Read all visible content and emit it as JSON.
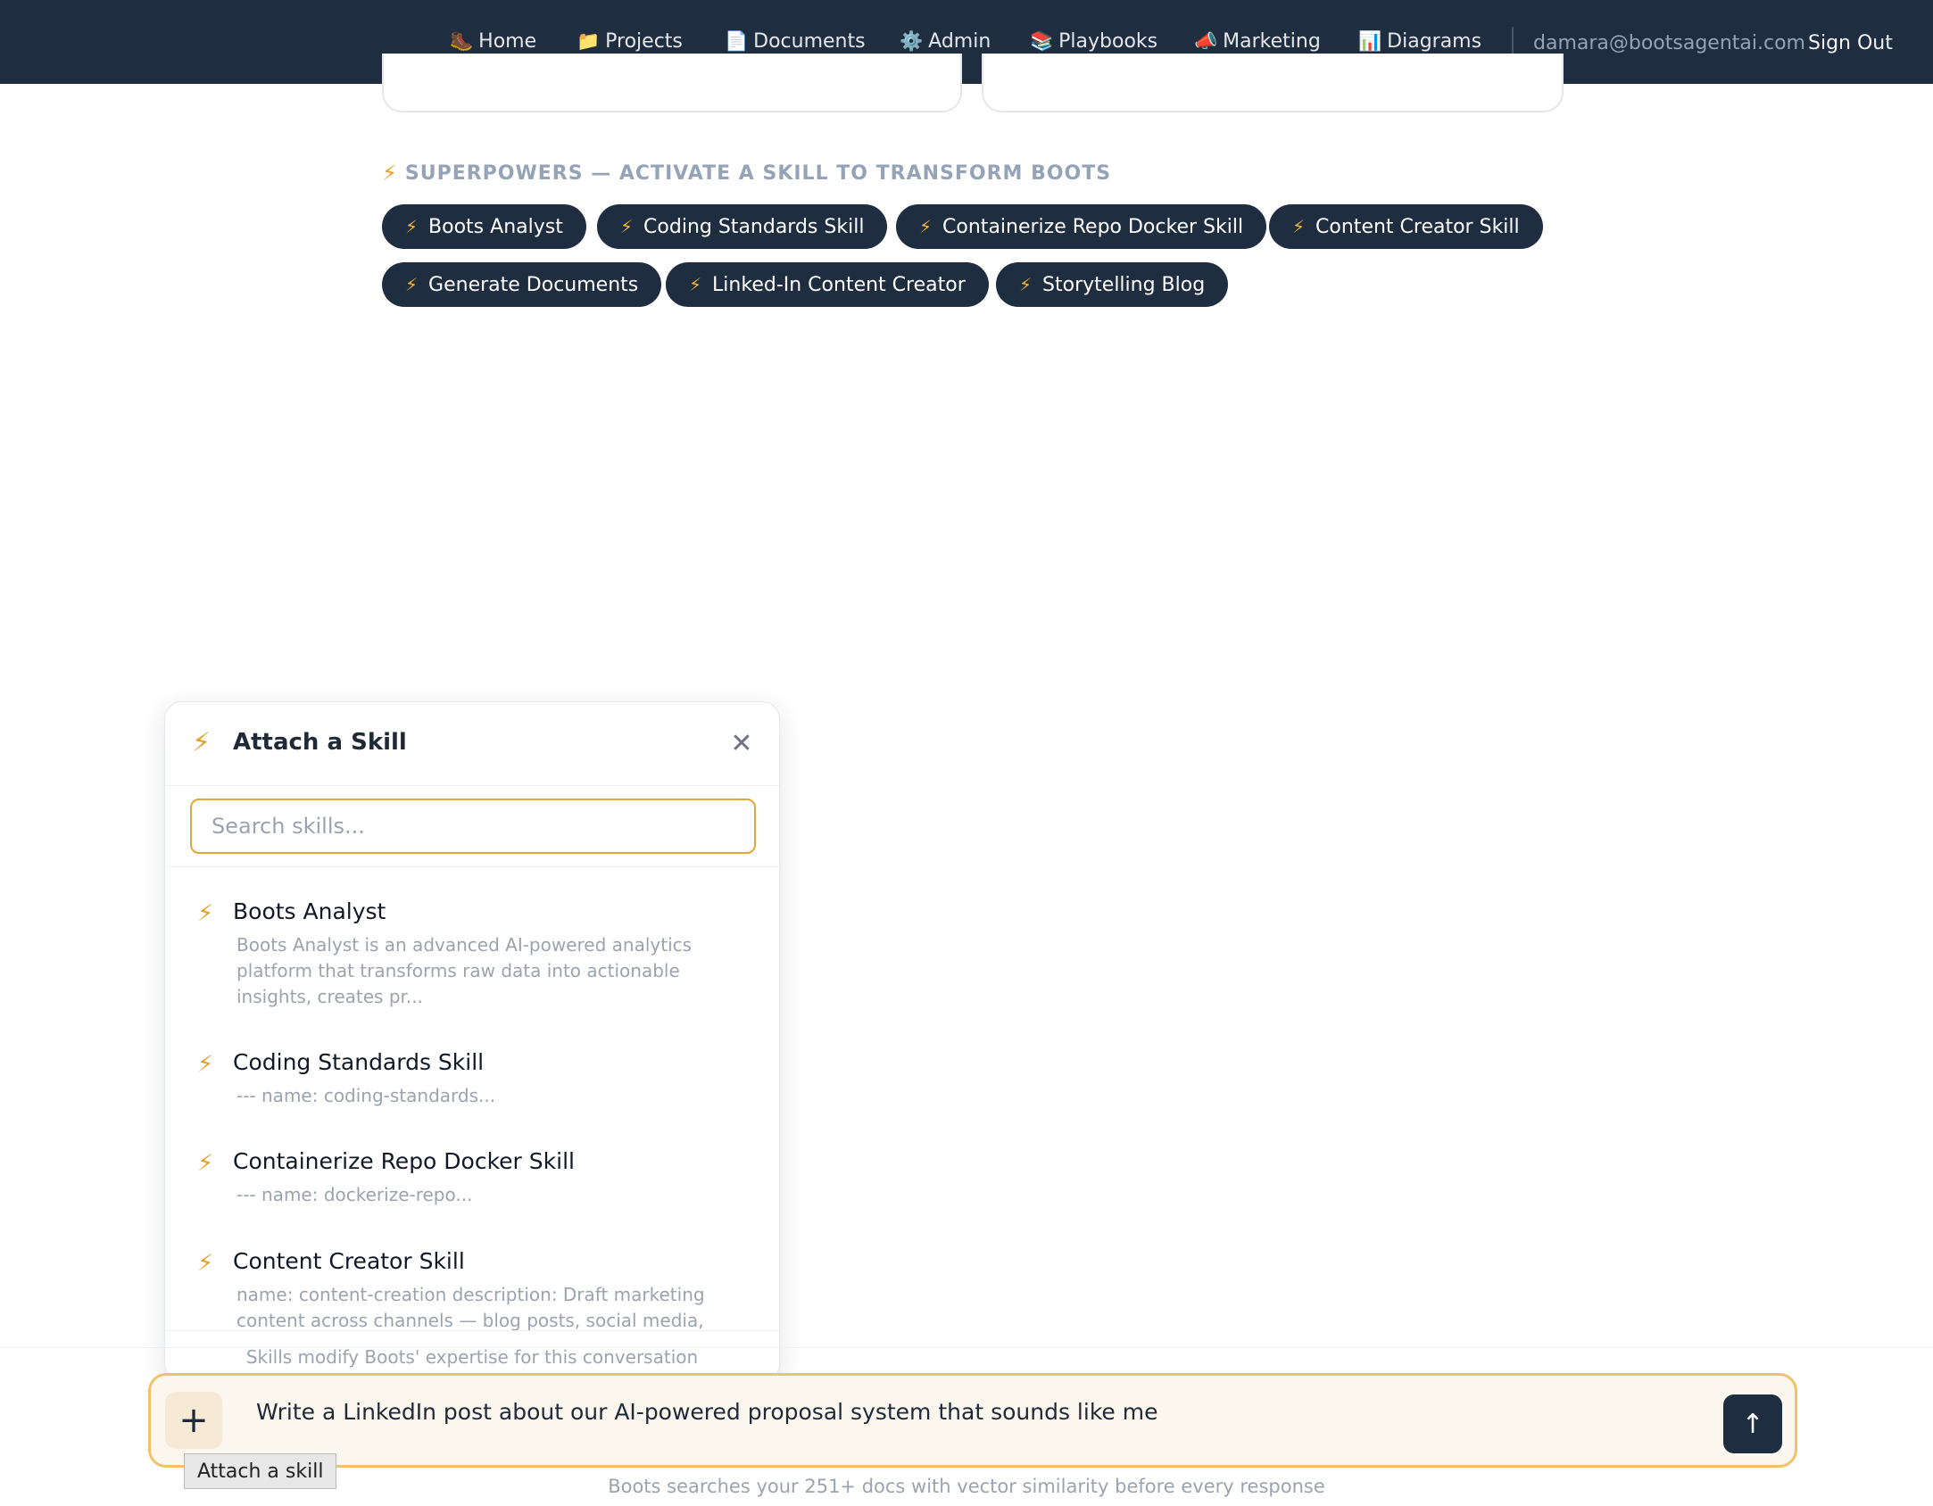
{
  "nav": {
    "items": [
      {
        "icon": "🥾",
        "icon_name": "boot-icon",
        "label": "Home"
      },
      {
        "icon": "📁",
        "icon_name": "folder-icon",
        "label": "Projects"
      },
      {
        "icon": "📄",
        "icon_name": "document-icon",
        "label": "Documents"
      },
      {
        "icon": "⚙️",
        "icon_name": "gear-icon",
        "label": "Admin"
      },
      {
        "icon": "📚",
        "icon_name": "books-icon",
        "label": "Playbooks"
      },
      {
        "icon": "📣",
        "icon_name": "megaphone-icon",
        "label": "Marketing"
      },
      {
        "icon": "📊",
        "icon_name": "bar-chart-icon",
        "label": "Diagrams"
      }
    ],
    "email": "damara@bootsagentai.com",
    "sign_out": "Sign Out"
  },
  "superpowers": {
    "heading": "SUPERPOWERS — ACTIVATE A SKILL TO TRANSFORM BOOTS",
    "bolt": "⚡",
    "chips": [
      "Boots Analyst",
      "Coding Standards Skill",
      "Containerize Repo Docker Skill",
      "Content Creator Skill",
      "Generate Documents",
      "Linked-In Content Creator",
      "Storytelling Blog"
    ]
  },
  "skill_panel": {
    "title": "Attach a Skill",
    "close_glyph": "✕",
    "search_placeholder": "Search skills...",
    "search_value": "",
    "skills": [
      {
        "name": "Boots Analyst",
        "desc": "Boots Analyst is an advanced AI-powered analytics platform that transforms raw data into actionable insights, creates pr..."
      },
      {
        "name": "Coding Standards Skill",
        "desc": "--- name: coding-standards..."
      },
      {
        "name": "Containerize Repo Docker Skill",
        "desc": "--- name: dockerize-repo..."
      },
      {
        "name": "Content Creator Skill",
        "desc": "name: content-creation description: Draft marketing content across channels — blog posts, social media,"
      }
    ],
    "footer": "Skills modify Boots' expertise for this conversation"
  },
  "composer": {
    "attach_glyph": "+",
    "text": "Write a LinkedIn post about our AI-powered proposal system that sounds like me",
    "send_glyph": "↑",
    "tooltip": "Attach a skill",
    "footnote": "Boots searches your 251+ docs with vector similarity before every response"
  },
  "colors": {
    "nav_bg": "#1f2d40",
    "accent": "#e3a02b",
    "chip_bg": "#1f2d40",
    "composer_border": "#f0c26b"
  }
}
